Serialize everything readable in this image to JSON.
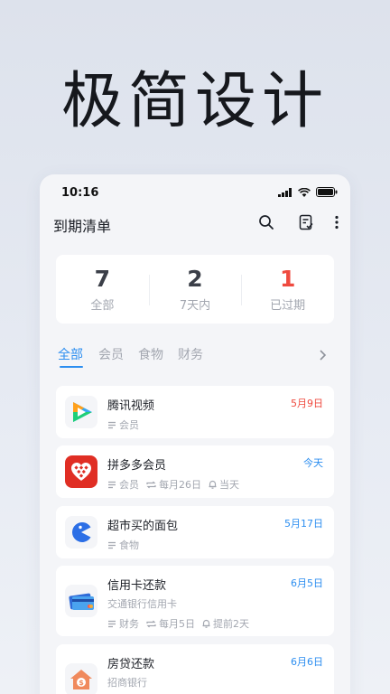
{
  "hero": {
    "title": "极简设计"
  },
  "status_bar": {
    "time": "10:16"
  },
  "app": {
    "title": "到期清单"
  },
  "summary": [
    {
      "count": "7",
      "label": "全部"
    },
    {
      "count": "2",
      "label": "7天内"
    },
    {
      "count": "1",
      "label": "已过期"
    }
  ],
  "tabs": [
    "全部",
    "会员",
    "食物",
    "财务"
  ],
  "items": [
    {
      "name": "腾讯视频",
      "due": "5月9日",
      "due_color": "#ef4a3f",
      "category": "会员",
      "logo": "tencent-video-logo"
    },
    {
      "name": "拼多多会员",
      "due": "今天",
      "due_color": "#2c8ef0",
      "category": "会员",
      "repeat": "每月26日",
      "remind": "当天",
      "logo": "pinduoduo-logo"
    },
    {
      "name": "超市买的面包",
      "due": "5月17日",
      "due_color": "#2c8ef0",
      "category": "食物",
      "logo": "pacman-logo"
    },
    {
      "name": "信用卡还款",
      "due": "6月5日",
      "due_color": "#2c8ef0",
      "subtitle": "交通银行信用卡",
      "category": "财务",
      "repeat": "每月5日",
      "remind": "提前2天",
      "logo": "credit-card-logo"
    },
    {
      "name": "房贷还款",
      "due": "6月6日",
      "due_color": "#2c8ef0",
      "subtitle": "招商银行",
      "logo": "house-loan-logo"
    }
  ]
}
